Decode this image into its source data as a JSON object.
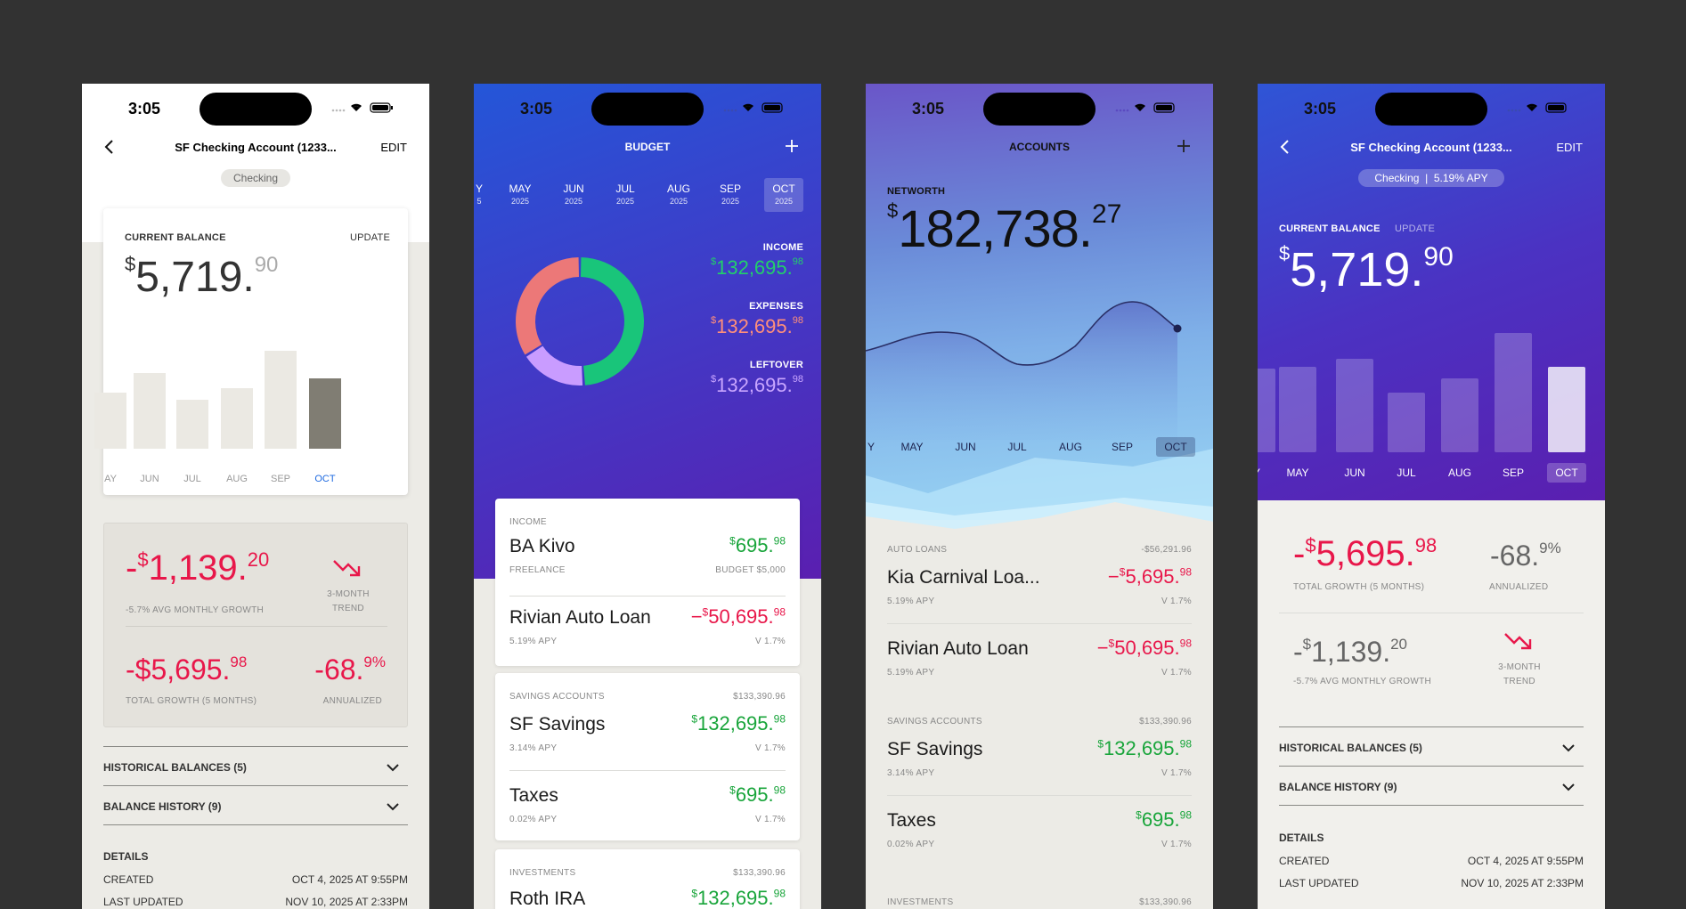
{
  "status": {
    "time": "3:05"
  },
  "screen1": {
    "nav_title": "SF Checking Account (1233...",
    "edit": "EDIT",
    "chip": "Checking",
    "balance_label": "CURRENT BALANCE",
    "update": "UPDATE",
    "balance_dollar": "$",
    "balance_main": "5,719.",
    "balance_cents": "90",
    "months": [
      "AY",
      "JUN",
      "JUL",
      "AUG",
      "SEP",
      "OCT"
    ],
    "bar_levels": [
      0.52,
      0.7,
      0.45,
      0.56,
      0.9,
      0.65
    ],
    "growth_sign": "-",
    "growth_dollar": "$",
    "growth_main": "1,139.",
    "growth_cents": "20",
    "growth_label": "-5.7% AVG MONTHLY GROWTH",
    "trend_label": "3-MONTH",
    "trend_label2": "TREND",
    "total_main": "-$5,695.",
    "total_cents": "98",
    "total_label": "TOTAL GROWTH (5 MONTHS)",
    "annual_main": "-68.",
    "annual_cents": "9%",
    "annual_label": "ANNUALIZED",
    "historical": "HISTORICAL BALANCES (5)",
    "history": "BALANCE HISTORY (9)",
    "details": "DETAILS",
    "created_label": "CREATED",
    "created_value": "OCT 4, 2025 AT 9:55PM",
    "updated_label": "LAST UPDATED",
    "updated_value": "NOV 10, 2025 AT 2:33PM"
  },
  "screen2": {
    "nav_title": "BUDGET",
    "months": [
      {
        "m": "Y",
        "y": "5"
      },
      {
        "m": "MAY",
        "y": "2025"
      },
      {
        "m": "JUN",
        "y": "2025"
      },
      {
        "m": "JUL",
        "y": "2025"
      },
      {
        "m": "AUG",
        "y": "2025"
      },
      {
        "m": "SEP",
        "y": "2025"
      },
      {
        "m": "OCT",
        "y": "2025"
      }
    ],
    "income_label": "INCOME",
    "income_value": "132,695.",
    "income_cents": "98",
    "expenses_label": "EXPENSES",
    "expenses_value": "132,695.",
    "expenses_cents": "98",
    "leftover_label": "LEFTOVER",
    "leftover_value": "132,695.",
    "leftover_cents": "98",
    "donut": {
      "income_share": 0.49,
      "expenses_share": 0.34,
      "leftover_share": 0.17
    },
    "card1_header": "INCOME",
    "row1_title": "BA Kivo",
    "row1_sub": "FREELANCE",
    "row1_amt": "695.",
    "row1_cents": "98",
    "row1_meta": "BUDGET $5,000",
    "row2_title": "Rivian Auto Loan",
    "row2_sub": "5.19% APY",
    "row2_amt": "50,695.",
    "row2_cents": "98",
    "row2_meta": "V 1.7%",
    "card2_header": "SAVINGS ACCOUNTS",
    "card2_total": "$133,390.96",
    "row3_title": "SF Savings",
    "row3_sub": "3.14% APY",
    "row3_amt": "132,695.",
    "row3_cents": "98",
    "row3_meta": "V 1.7%",
    "row4_title": "Taxes",
    "row4_sub": "0.02% APY",
    "row4_amt": "695.",
    "row4_cents": "98",
    "row4_meta": "V 1.7%",
    "card3_header": "INVESTMENTS",
    "card3_total": "$133,390.96",
    "row5_title": "Roth IRA",
    "row5_amt": "132,695.",
    "row5_cents": "98"
  },
  "screen3": {
    "nav_title": "ACCOUNTS",
    "networth_label": "NETWORTH",
    "networth_main": "182,738.",
    "networth_cents": "27",
    "months": [
      "Y",
      "MAY",
      "JUN",
      "JUL",
      "AUG",
      "SEP",
      "OCT"
    ],
    "sec1_header": "AUTO LOANS",
    "sec1_total": "-$56,291.96",
    "r1_title": "Kia Carnival Loa...",
    "r1_sub": "5.19% APY",
    "r1_amt": "5,695.",
    "r1_cents": "98",
    "r1_meta": "V 1.7%",
    "r2_title": "Rivian Auto Loan",
    "r2_sub": "5.19% APY",
    "r2_amt": "50,695.",
    "r2_cents": "98",
    "r2_meta": "V 1.7%",
    "sec2_header": "SAVINGS ACCOUNTS",
    "sec2_total": "$133,390.96",
    "r3_title": "SF Savings",
    "r3_sub": "3.14% APY",
    "r3_amt": "132,695.",
    "r3_cents": "98",
    "r3_meta": "V 1.7%",
    "r4_title": "Taxes",
    "r4_sub": "0.02% APY",
    "r4_amt": "695.",
    "r4_cents": "98",
    "r4_meta": "V 1.7%",
    "sec3_header": "INVESTMENTS",
    "sec3_total": "$133,390.96"
  },
  "screen4": {
    "nav_title": "SF Checking Account (1233...",
    "edit": "EDIT",
    "chip": "Checking  |  5.19% APY",
    "balance_label": "CURRENT BALANCE",
    "update": "UPDATE",
    "balance_main": "5,719.",
    "balance_cents": "90",
    "months": [
      "Y",
      "MAY",
      "JUN",
      "JUL",
      "AUG",
      "SEP",
      "OCT"
    ],
    "bar_levels": [
      0.7,
      0.72,
      0.78,
      0.5,
      0.62,
      1.0,
      0.72
    ],
    "total_main": "5,695.",
    "total_cents": "98",
    "total_label": "TOTAL GROWTH (5 MONTHS)",
    "annual_main": "-68.",
    "annual_cents": "9%",
    "annual_label": "ANNUALIZED",
    "growth_main": "1,139.",
    "growth_cents": "20",
    "growth_label": "-5.7% AVG MONTHLY GROWTH",
    "trend_label": "3-MONTH",
    "trend_label2": "TREND",
    "historical": "HISTORICAL BALANCES (5)",
    "history": "BALANCE HISTORY (9)",
    "details": "DETAILS",
    "created_label": "CREATED",
    "created_value": "OCT 4, 2025 AT 9:55PM",
    "updated_label": "LAST UPDATED",
    "updated_value": "NOV 10, 2025 AT 2:33PM"
  }
}
